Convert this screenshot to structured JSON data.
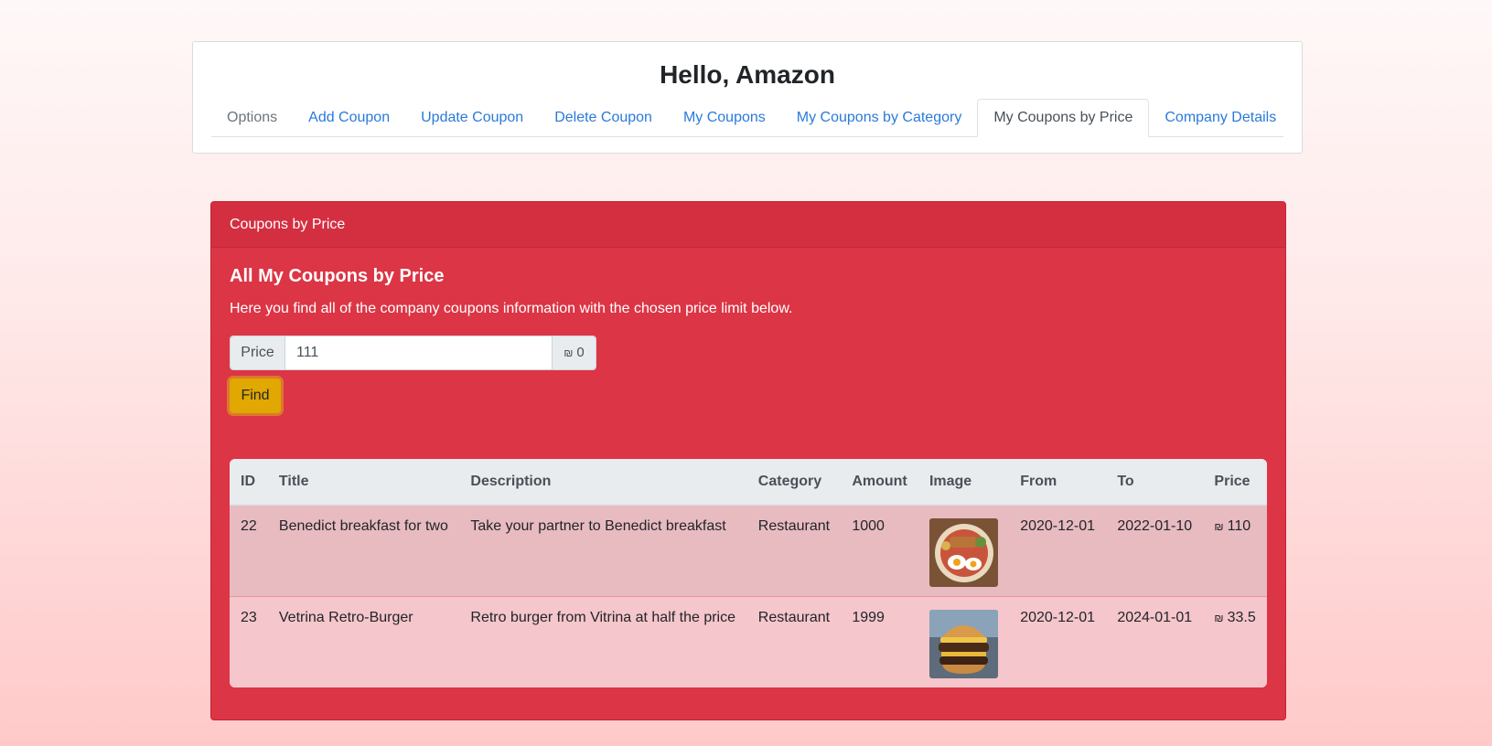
{
  "header": {
    "greeting": "Hello, Amazon",
    "tabs": [
      {
        "label": "Options",
        "state": "muted"
      },
      {
        "label": "Add Coupon",
        "state": "link"
      },
      {
        "label": "Update Coupon",
        "state": "link"
      },
      {
        "label": "Delete Coupon",
        "state": "link"
      },
      {
        "label": "My Coupons",
        "state": "link"
      },
      {
        "label": "My Coupons by Category",
        "state": "link"
      },
      {
        "label": "My Coupons by Price",
        "state": "active"
      },
      {
        "label": "Company Details",
        "state": "link"
      }
    ]
  },
  "panel": {
    "header": "Coupons by Price",
    "title": "All My Coupons by Price",
    "description": "Here you find all of the company coupons information with the chosen price limit below.",
    "price_label": "Price",
    "price_value": "111",
    "currency_symbol": "₪",
    "append_value": "0",
    "find_label": "Find"
  },
  "table": {
    "columns": [
      "ID",
      "Title",
      "Description",
      "Category",
      "Amount",
      "Image",
      "From",
      "To",
      "Price"
    ],
    "rows": [
      {
        "id": "22",
        "title": "Benedict breakfast for two",
        "description": "Take your partner to Benedict breakfast",
        "category": "Restaurant",
        "amount": "1000",
        "image": "breakfast-plate-image",
        "from": "2020-12-01",
        "to": "2022-01-10",
        "price": "110"
      },
      {
        "id": "23",
        "title": "Vetrina Retro-Burger",
        "description": "Retro burger from Vitrina at half the price",
        "category": "Restaurant",
        "amount": "1999",
        "image": "burger-image",
        "from": "2020-12-01",
        "to": "2024-01-01",
        "price": "33.5"
      }
    ]
  },
  "colors": {
    "panel_bg": "#dc3545",
    "find_button": "#e0a800",
    "link": "#2a7ad9"
  }
}
